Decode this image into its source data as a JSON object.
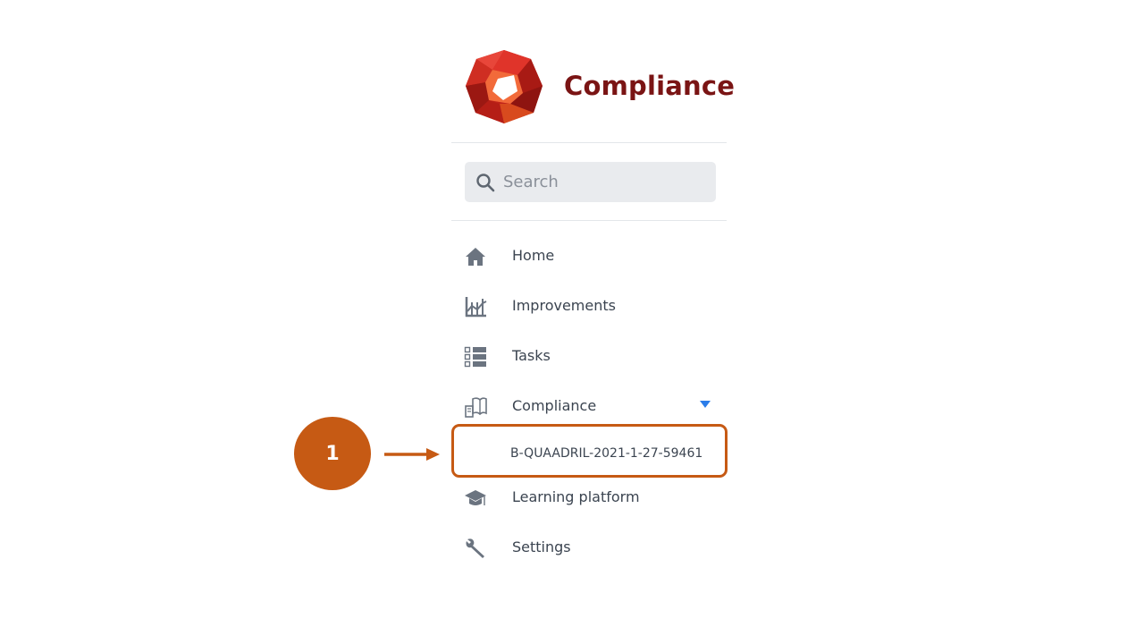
{
  "app": {
    "title": "Compliance"
  },
  "search": {
    "placeholder": "Search"
  },
  "nav": {
    "items": [
      {
        "label": "Home",
        "icon": "home-icon"
      },
      {
        "label": "Improvements",
        "icon": "chart-icon"
      },
      {
        "label": "Tasks",
        "icon": "checklist-icon"
      },
      {
        "label": "Compliance",
        "icon": "book-icon",
        "expanded": true
      },
      {
        "label": "Learning platform",
        "icon": "graduation-cap-icon"
      },
      {
        "label": "Settings",
        "icon": "wrench-icon"
      }
    ],
    "compliance_subitems": [
      {
        "label": "B-QUAADRIL-2021-1-27-59461"
      }
    ]
  },
  "callout": {
    "step_number": "1"
  },
  "colors": {
    "brand": "#7a1414",
    "callout": "#c65a14",
    "caret": "#2b7de9",
    "icon": "#6b7480",
    "text": "#3b4450"
  }
}
